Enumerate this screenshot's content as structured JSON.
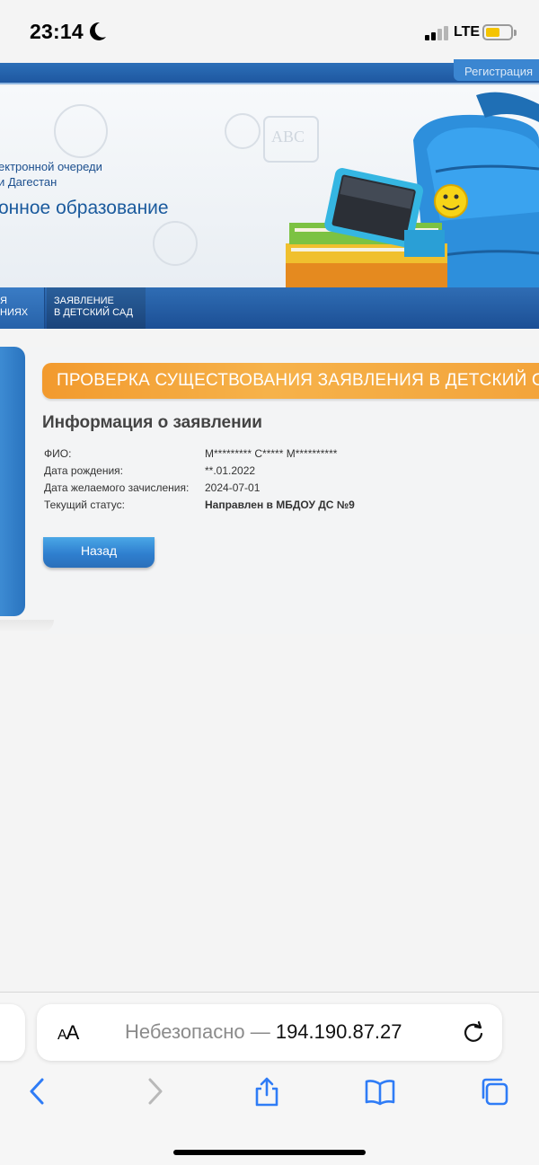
{
  "status_bar": {
    "time": "23:14",
    "network": "LTE",
    "icons": [
      "moon-icon",
      "signal-icon",
      "battery-icon"
    ],
    "battery_color": "#f5c400"
  },
  "site": {
    "top_link": "Регистрация",
    "banner": {
      "subtitle_line1": "ектронной очереди",
      "subtitle_line2": "и Дагестан",
      "title": "онное образование"
    },
    "nav": [
      {
        "line1": "Я",
        "line2": "НИЯХ"
      },
      {
        "line1": "ЗАЯВЛЕНИЕ",
        "line2": "В ДЕТСКИЙ САД"
      }
    ],
    "section_header": "ПРОВЕРКА СУЩЕСТВОВАНИЯ ЗАЯВЛЕНИЯ В ДЕТСКИЙ САД",
    "info": {
      "heading": "Информация о заявлении",
      "rows": [
        {
          "label": "ФИО:",
          "value": "М********* С***** М**********"
        },
        {
          "label": "Дата рождения:",
          "value": "**.01.2022"
        },
        {
          "label": "Дата желаемого зачисления:",
          "value": "2024-07-01"
        },
        {
          "label": "Текущий статус:",
          "value": "Направлен в МБДОУ ДС №9"
        }
      ]
    },
    "back_button": "Назад",
    "colors": {
      "header_blue": "#1e57a0",
      "accent_orange": "#f29a2e",
      "button_blue": "#2f7fcf"
    }
  },
  "safari": {
    "aa_label_small": "A",
    "aa_label_big": "A",
    "address_insecure": "Небезопасно — ",
    "address_host": "194.190.87.27",
    "toolbar": [
      "back-icon",
      "forward-icon",
      "share-icon",
      "bookmarks-icon",
      "tabs-icon"
    ]
  }
}
